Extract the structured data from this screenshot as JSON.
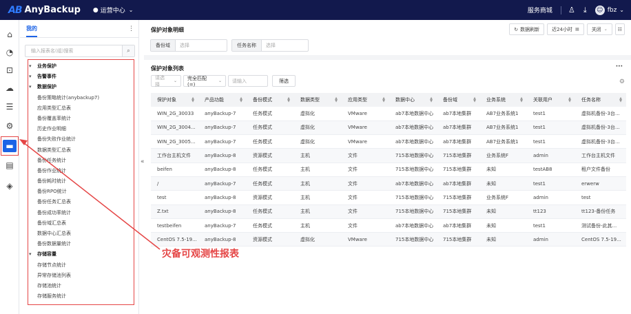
{
  "header": {
    "logo_mark": "AB",
    "logo_text": "AnyBackup",
    "center": "运营中心",
    "store": "服务商城",
    "user": "fbz"
  },
  "rail": {
    "icons": [
      "home-icon",
      "dashboard-icon",
      "monitor-icon",
      "cloud-icon",
      "resource-icon",
      "cluster-icon",
      "report-icon",
      "storage-icon",
      "layers-icon"
    ],
    "active": "report-icon"
  },
  "menu": {
    "tab": "我的",
    "search_placeholder": "输入报表名(组)搜索",
    "items": [
      {
        "label": "业务保护",
        "group": true
      },
      {
        "label": "告警事件",
        "group": true
      },
      {
        "label": "数据保护",
        "group": true
      },
      {
        "label": "备份策略统计(anybackup7)",
        "group": false
      },
      {
        "label": "应用类型汇总表",
        "group": false
      },
      {
        "label": "备份覆盖率统计",
        "group": false
      },
      {
        "label": "历史作业明细",
        "group": false
      },
      {
        "label": "备份失败作业统计",
        "group": false
      },
      {
        "label": "数据类型汇总表",
        "group": false
      },
      {
        "label": "备份任务统计",
        "group": false
      },
      {
        "label": "备份作业统计",
        "group": false
      },
      {
        "label": "备份耗时统计",
        "group": false
      },
      {
        "label": "备份RPO统计",
        "group": false
      },
      {
        "label": "备份任务汇总表",
        "group": false
      },
      {
        "label": "备份成功率统计",
        "group": false
      },
      {
        "label": "备份域汇总表",
        "group": false
      },
      {
        "label": "数据中心汇总表",
        "group": false
      },
      {
        "label": "备份数据量统计",
        "group": false
      },
      {
        "label": "存储容量",
        "group": true
      },
      {
        "label": "存储节点统计",
        "group": false
      },
      {
        "label": "异常存储池列表",
        "group": false
      },
      {
        "label": "存储池统计",
        "group": false
      },
      {
        "label": "存储服务统计",
        "group": false
      }
    ]
  },
  "filter": {
    "title": "保护对象明细",
    "refresh": "数据刷新",
    "range": "近24小时",
    "close": "关闭",
    "field1_label": "备份域",
    "field1_value": "选择",
    "field2_label": "任务名称",
    "field2_value": "选择"
  },
  "list": {
    "title": "保护对象列表",
    "select_placeholder": "请选择",
    "match": "完全匹配 (=)",
    "input_placeholder": "请输入",
    "filter_btn": "筛选",
    "columns": [
      "保护对象",
      "产品功能",
      "备份模式",
      "数据类型",
      "应用类型",
      "数据中心",
      "备份域",
      "业务系统",
      "关联用户",
      "任务名称"
    ],
    "rows": [
      [
        "WIN_2G_30033",
        "anyBackup-7",
        "任务模式",
        "虚拟化",
        "VMware",
        "ab7本地数据中心",
        "ab7本地集群",
        "AB7业务系统1",
        "test1",
        "虚拟机备份-3台..."
      ],
      [
        "WIN_2G_3004...",
        "anyBackup-7",
        "任务模式",
        "虚拟化",
        "VMware",
        "ab7本地数据中心",
        "ab7本地集群",
        "AB7业务系统1",
        "test1",
        "虚拟机备份-3台..."
      ],
      [
        "WIN_2G_3005...",
        "anyBackup-7",
        "任务模式",
        "虚拟化",
        "VMware",
        "ab7本地数据中心",
        "ab7本地集群",
        "AB7业务系统1",
        "test1",
        "虚拟机备份-3台..."
      ],
      [
        "工作台主机文件",
        "anyBackup-8",
        "资源模式",
        "主机",
        "文件",
        "715本地数据中心",
        "715本地集群",
        "业务系统F",
        "admin",
        "工作台主机文件"
      ],
      [
        "beifen",
        "anyBackup-8",
        "任务模式",
        "主机",
        "文件",
        "715本地数据中心",
        "715本地集群",
        "未知",
        "testAB8",
        "租户文件备份"
      ],
      [
        "/",
        "anyBackup-7",
        "任务模式",
        "主机",
        "文件",
        "ab7本地数据中心",
        "ab7本地集群",
        "未知",
        "test1",
        "erwerw"
      ],
      [
        "test",
        "anyBackup-8",
        "资源模式",
        "主机",
        "文件",
        "715本地数据中心",
        "715本地集群",
        "业务系统F",
        "admin",
        "test"
      ],
      [
        "Z.txt",
        "anyBackup-8",
        "任务模式",
        "主机",
        "文件",
        "715本地数据中心",
        "715本地集群",
        "未知",
        "tt123",
        "tt123-备份任务"
      ],
      [
        "testbeifen",
        "anyBackup-7",
        "任务模式",
        "主机",
        "文件",
        "ab7本地数据中心",
        "ab7本地集群",
        "未知",
        "test1",
        "测试备份-此其..."
      ],
      [
        "CentOS 7.5-19...",
        "anyBackup-8",
        "资源模式",
        "虚拟化",
        "VMware",
        "715本地数据中心",
        "715本地集群",
        "未知",
        "admin",
        "CentOS 7.5-19..."
      ]
    ]
  },
  "annotation": {
    "text": "灾备可观测性报表",
    "color": "#e54545"
  },
  "colors": {
    "header_bg": "#12194d",
    "accent": "#1c63e6",
    "annotation": "#e54545"
  }
}
